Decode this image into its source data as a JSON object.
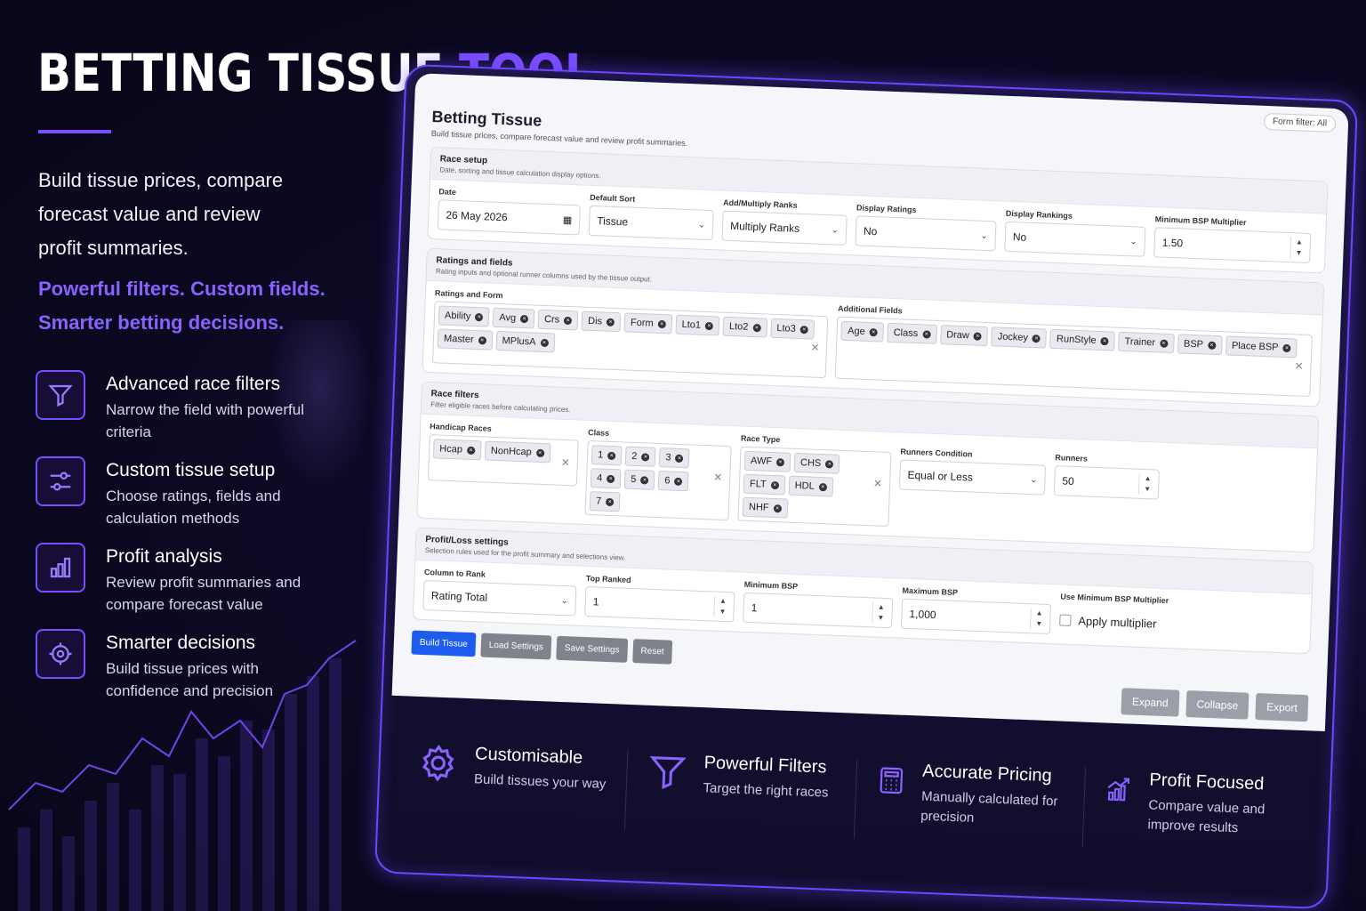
{
  "hero": {
    "title_main": "BETTING TISSUE ",
    "title_accent": "TOOL",
    "intro": "Build tissue prices, compare forecast value and review profit summaries.",
    "tagline": "Powerful filters. Custom fields. Smarter betting decisions."
  },
  "features": [
    {
      "title": "Advanced race filters",
      "desc": "Narrow the field with powerful criteria",
      "icon": "funnel-icon"
    },
    {
      "title": "Custom tissue setup",
      "desc": "Choose ratings, fields and calculation methods",
      "icon": "sliders-icon"
    },
    {
      "title": "Profit analysis",
      "desc": "Review profit summaries and compare forecast value",
      "icon": "bar-chart-icon"
    },
    {
      "title": "Smarter decisions",
      "desc": "Build tissue prices with confidence and precision",
      "icon": "target-icon"
    }
  ],
  "app": {
    "form_filter": "Form filter: All",
    "title": "Betting Tissue",
    "subtitle": "Build tissue prices, compare forecast value and review profit summaries.",
    "race_setup": {
      "title": "Race setup",
      "subtitle": "Date, sorting and tissue calculation display options.",
      "date_label": "Date",
      "date_value": "26 May 2026",
      "sort_label": "Default Sort",
      "sort_value": "Tissue",
      "ranks_label": "Add/Multiply Ranks",
      "ranks_value": "Multiply Ranks",
      "ratings_label": "Display Ratings",
      "ratings_value": "No",
      "rankings_label": "Display Rankings",
      "rankings_value": "No",
      "mult_label": "Minimum BSP Multiplier",
      "mult_value": "1.50"
    },
    "ratings": {
      "title": "Ratings and fields",
      "subtitle": "Rating inputs and optional runner columns used by the tissue output.",
      "form_label": "Ratings and Form",
      "form_tags": [
        "Ability",
        "Avg",
        "Crs",
        "Dis",
        "Form",
        "Lto1",
        "Lto2",
        "Lto3",
        "Master",
        "MPlusA"
      ],
      "fields_label": "Additional Fields",
      "field_tags": [
        "Age",
        "Class",
        "Draw",
        "Jockey",
        "RunStyle",
        "Trainer",
        "BSP",
        "Place BSP"
      ]
    },
    "filters": {
      "title": "Race filters",
      "subtitle": "Filter eligible races before calculating prices.",
      "handicap_label": "Handicap Races",
      "handicap_tags": [
        "Hcap",
        "NonHcap"
      ],
      "class_label": "Class",
      "class_tags": [
        "1",
        "2",
        "3",
        "4",
        "5",
        "6",
        "7"
      ],
      "type_label": "Race Type",
      "type_tags": [
        "AWF",
        "CHS",
        "FLT",
        "HDL",
        "NHF"
      ],
      "cond_label": "Runners Condition",
      "cond_value": "Equal or Less",
      "runners_label": "Runners",
      "runners_value": "50"
    },
    "pl": {
      "title": "Profit/Loss settings",
      "subtitle": "Selection rules used for the profit summary and selections view.",
      "col_label": "Column to Rank",
      "col_value": "Rating Total",
      "top_label": "Top Ranked",
      "top_value": "1",
      "minbsp_label": "Minimum BSP",
      "minbsp_value": "1",
      "maxbsp_label": "Maximum BSP",
      "maxbsp_value": "1,000",
      "use_label": "Use Minimum BSP Multiplier",
      "use_check": "Apply multiplier"
    },
    "buttons": {
      "build": "Build Tissue",
      "load": "Load Settings",
      "save": "Save Settings",
      "reset": "Reset",
      "expand": "Expand",
      "collapse": "Collapse",
      "export": "Export"
    }
  },
  "strip": [
    {
      "title": "Customisable",
      "desc": "Build tissues your way",
      "icon": "gear-icon"
    },
    {
      "title": "Powerful Filters",
      "desc": "Target the right races",
      "icon": "funnel-icon"
    },
    {
      "title": "Accurate Pricing",
      "desc": "Manually calculated for precision",
      "icon": "calculator-icon"
    },
    {
      "title": "Profit Focused",
      "desc": "Compare value and improve results",
      "icon": "growth-chart-icon"
    }
  ],
  "colors": {
    "accent": "#7b4dff",
    "primary_button": "#1e5cf0",
    "background": "#0d0a26"
  }
}
